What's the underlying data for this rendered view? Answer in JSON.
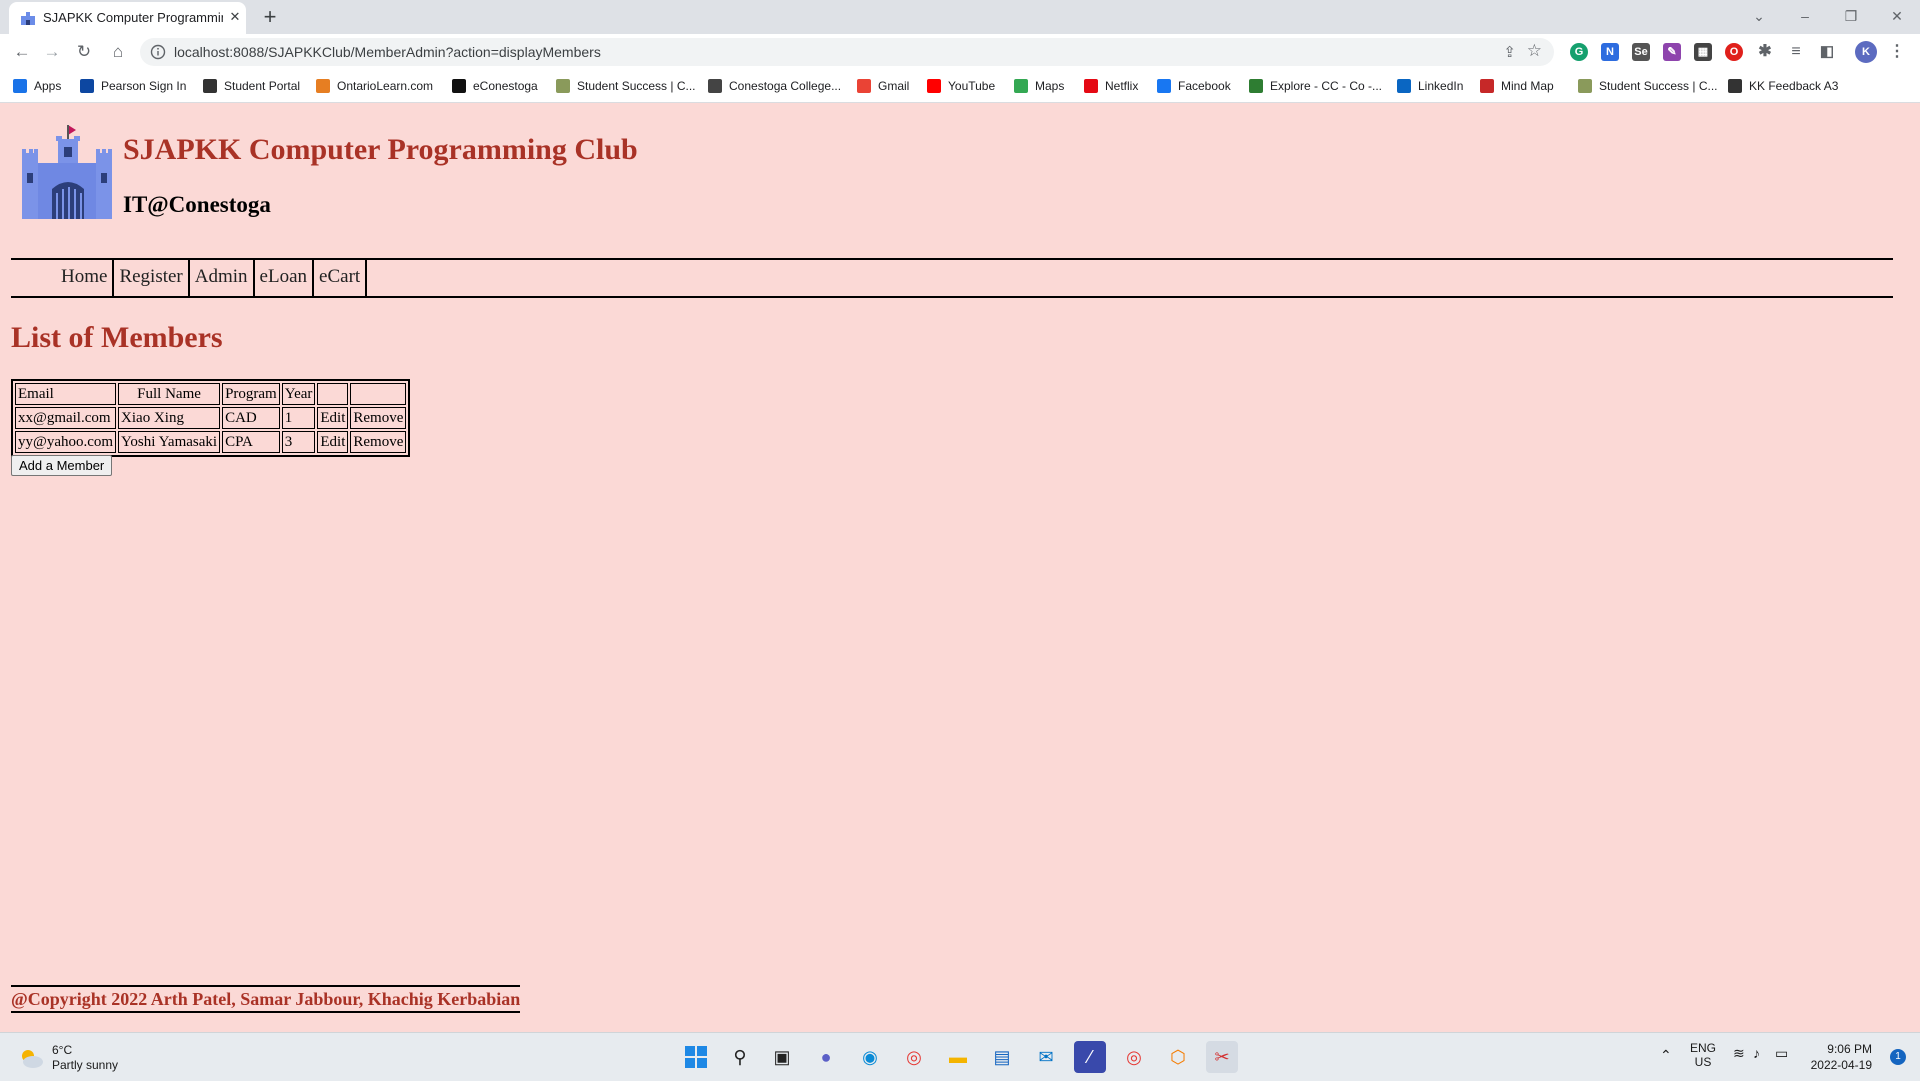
{
  "browser": {
    "tab_title": "SJAPKK Computer Programming",
    "url": "localhost:8088/SJAPKKClub/MemberAdmin?action=displayMembers",
    "profile_initial": "K",
    "bookmarks": [
      {
        "label": "Apps",
        "icon": "apps-grid-icon",
        "color": "#1a73e8"
      },
      {
        "label": "Pearson Sign In",
        "icon": "pearson-icon",
        "color": "#0d47a1"
      },
      {
        "label": "Student Portal",
        "icon": "globe-icon",
        "color": "#333333"
      },
      {
        "label": "OntarioLearn.com",
        "icon": "ontariolearn-icon",
        "color": "#e67e22"
      },
      {
        "label": "eConestoga",
        "icon": "d2l-icon",
        "color": "#111111"
      },
      {
        "label": "Student Success | C...",
        "icon": "conestoga-icon",
        "color": "#8a9a5b"
      },
      {
        "label": "Conestoga College...",
        "icon": "conestoga-c-icon",
        "color": "#444444"
      },
      {
        "label": "Gmail",
        "icon": "gmail-icon",
        "color": "#ea4335"
      },
      {
        "label": "YouTube",
        "icon": "youtube-icon",
        "color": "#ff0000"
      },
      {
        "label": "Maps",
        "icon": "maps-icon",
        "color": "#34a853"
      },
      {
        "label": "Netflix",
        "icon": "netflix-icon",
        "color": "#e50914"
      },
      {
        "label": "Facebook",
        "icon": "facebook-icon",
        "color": "#1877f2"
      },
      {
        "label": "Explore - CC - Co -...",
        "icon": "explore-icon",
        "color": "#2e7d32"
      },
      {
        "label": "LinkedIn",
        "icon": "linkedin-icon",
        "color": "#0a66c2"
      },
      {
        "label": "Mind Map",
        "icon": "mindmap-icon",
        "color": "#c62828"
      },
      {
        "label": "Student Success | C...",
        "icon": "conestoga-icon",
        "color": "#8a9a5b"
      },
      {
        "label": "KK Feedback A3",
        "icon": "globe-icon",
        "color": "#333333"
      }
    ]
  },
  "site": {
    "title": "SJAPKK Computer Programming Club",
    "subtitle": "IT@Conestoga",
    "nav": [
      "Home",
      "Register",
      "Admin",
      "eLoan",
      "eCart"
    ]
  },
  "members": {
    "heading": "List of Members",
    "columns": [
      "Email",
      "Full Name",
      "Program",
      "Year"
    ],
    "rows": [
      {
        "email": "xx@gmail.com",
        "name": "Xiao Xing",
        "program": "CAD",
        "year": "1",
        "edit": "Edit",
        "remove": "Remove"
      },
      {
        "email": "yy@yahoo.com",
        "name": "Yoshi Yamasaki",
        "program": "CPA",
        "year": "3",
        "edit": "Edit",
        "remove": "Remove"
      }
    ],
    "add_button": "Add a Member"
  },
  "footer": {
    "copyright": "@Copyright 2022 Arth Patel, Samar Jabbour, Khachig Kerbabian"
  },
  "taskbar": {
    "weather_temp": "6°C",
    "weather_desc": "Partly sunny",
    "lang_1": "ENG",
    "lang_2": "US",
    "time": "9:06 PM",
    "date": "2022-04-19",
    "notifications": "1"
  }
}
